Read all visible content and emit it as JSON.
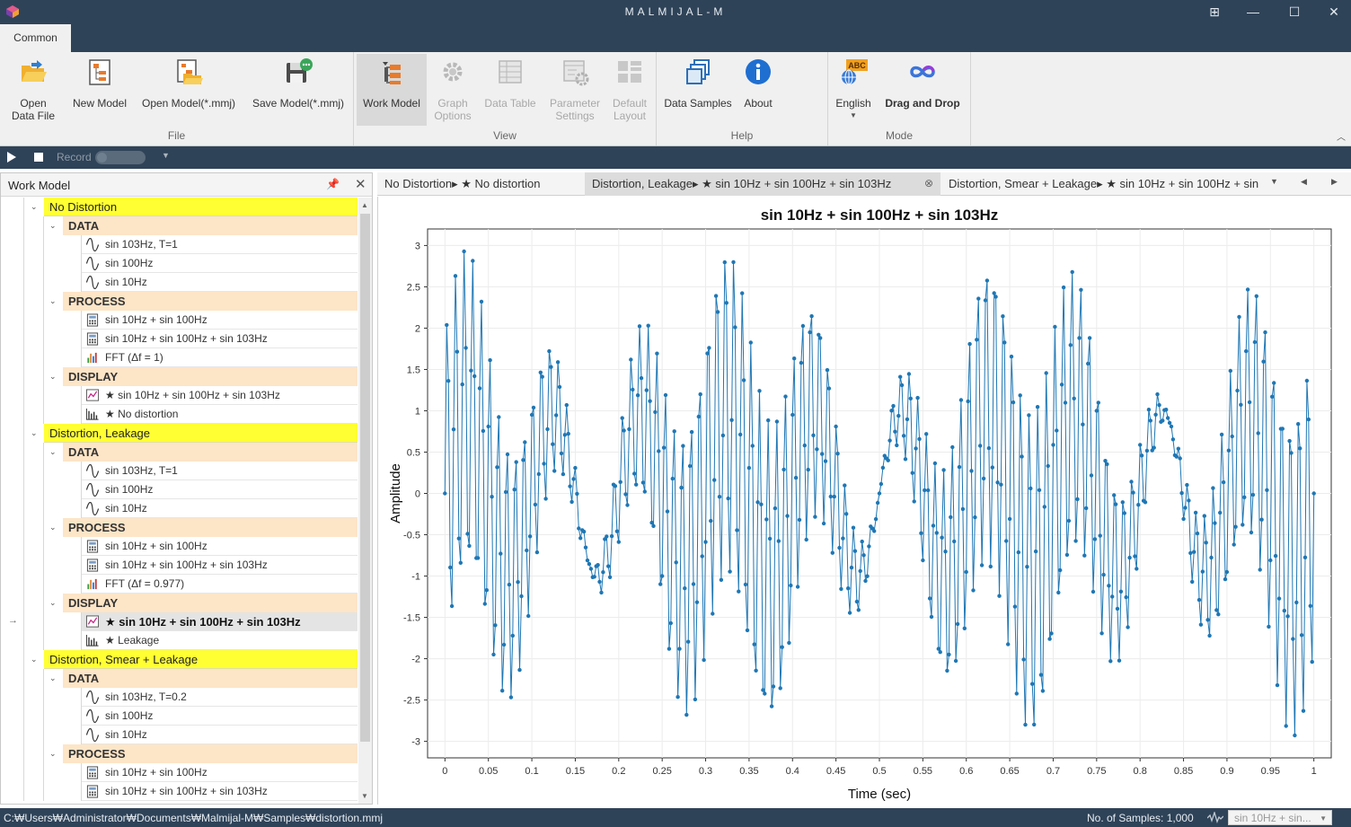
{
  "window": {
    "title": "MALMIJAL-M",
    "controls": [
      "restore-icon",
      "minimize-icon",
      "maximize-icon",
      "close-icon"
    ]
  },
  "ribbon": {
    "tab": "Common",
    "groups": {
      "file": {
        "label": "File",
        "buttons": [
          {
            "label": "Open Data File",
            "icon": "open-folder-icon"
          },
          {
            "label": "New Model",
            "icon": "new-model-icon"
          },
          {
            "label": "Open Model(*.mmj)",
            "icon": "open-model-icon"
          },
          {
            "label": "Save Model(*.mmj)",
            "icon": "save-model-icon"
          }
        ]
      },
      "view": {
        "label": "View",
        "buttons": [
          {
            "label": "Work Model",
            "icon": "work-model-icon",
            "state": "active"
          },
          {
            "label": "Graph Options",
            "icon": "graph-options-icon",
            "state": "disabled"
          },
          {
            "label": "Data Table",
            "icon": "data-table-icon",
            "state": "disabled"
          },
          {
            "label": "Parameter Settings",
            "icon": "parameter-settings-icon",
            "state": "disabled"
          },
          {
            "label": "Default Layout",
            "icon": "default-layout-icon",
            "state": "disabled"
          }
        ]
      },
      "help": {
        "label": "Help",
        "buttons": [
          {
            "label": "Data Samples",
            "icon": "data-samples-icon"
          },
          {
            "label": "About",
            "icon": "info-icon"
          }
        ]
      },
      "mode": {
        "label": "Mode",
        "buttons": [
          {
            "label": "English",
            "icon": "language-abc-icon"
          },
          {
            "label": "Drag and Drop",
            "icon": "drag-drop-icon"
          }
        ]
      }
    }
  },
  "toolbar": {
    "record_label": "Record"
  },
  "panel": {
    "title": "Work Model",
    "tree": [
      {
        "level": 1,
        "label": "No Distortion"
      },
      {
        "level": 2,
        "label": "DATA"
      },
      {
        "level": 3,
        "label": "sin 103Hz, T=1",
        "icon": "sine-wave-icon"
      },
      {
        "level": 3,
        "label": "sin 100Hz",
        "icon": "sine-wave-icon"
      },
      {
        "level": 3,
        "label": "sin 10Hz",
        "icon": "sine-wave-icon"
      },
      {
        "level": 2,
        "label": "PROCESS"
      },
      {
        "level": 3,
        "label": "sin 10Hz + sin 100Hz",
        "icon": "calculator-icon"
      },
      {
        "level": 3,
        "label": "sin 10Hz + sin 100Hz + sin 103Hz",
        "icon": "calculator-icon"
      },
      {
        "level": 3,
        "label": "FFT (Δf = 1)",
        "icon": "fft-icon"
      },
      {
        "level": 2,
        "label": "DISPLAY"
      },
      {
        "level": 3,
        "label": "★ sin 10Hz + sin 100Hz + sin 103Hz",
        "icon": "line-chart-icon"
      },
      {
        "level": 3,
        "label": "★ No distortion",
        "icon": "bar-chart-icon"
      },
      {
        "level": 1,
        "label": "Distortion, Leakage"
      },
      {
        "level": 2,
        "label": "DATA"
      },
      {
        "level": 3,
        "label": "sin 103Hz, T=1",
        "icon": "sine-wave-icon"
      },
      {
        "level": 3,
        "label": "sin 100Hz",
        "icon": "sine-wave-icon"
      },
      {
        "level": 3,
        "label": "sin 10Hz",
        "icon": "sine-wave-icon"
      },
      {
        "level": 2,
        "label": "PROCESS"
      },
      {
        "level": 3,
        "label": "sin 10Hz + sin 100Hz",
        "icon": "calculator-icon"
      },
      {
        "level": 3,
        "label": "sin 10Hz + sin 100Hz + sin 103Hz",
        "icon": "calculator-icon"
      },
      {
        "level": 3,
        "label": "FFT (Δf = 0.977)",
        "icon": "fft-icon"
      },
      {
        "level": 2,
        "label": "DISPLAY"
      },
      {
        "level": 3,
        "label": "★ sin 10Hz + sin 100Hz + sin 103Hz",
        "icon": "line-chart-icon",
        "selected": true
      },
      {
        "level": 3,
        "label": "★ Leakage",
        "icon": "bar-chart-icon"
      },
      {
        "level": 1,
        "label": "Distortion, Smear + Leakage"
      },
      {
        "level": 2,
        "label": "DATA"
      },
      {
        "level": 3,
        "label": "sin 103Hz, T=0.2",
        "icon": "sine-wave-icon"
      },
      {
        "level": 3,
        "label": "sin 100Hz",
        "icon": "sine-wave-icon"
      },
      {
        "level": 3,
        "label": "sin 10Hz",
        "icon": "sine-wave-icon"
      },
      {
        "level": 2,
        "label": "PROCESS"
      },
      {
        "level": 3,
        "label": "sin 10Hz + sin 100Hz",
        "icon": "calculator-icon"
      },
      {
        "level": 3,
        "label": "sin 10Hz + sin 100Hz + sin 103Hz",
        "icon": "calculator-icon"
      }
    ]
  },
  "doc_tabs": [
    {
      "label": "No Distortion▸ ★ No distortion"
    },
    {
      "label": "Distortion, Leakage▸ ★ sin 10Hz + sin 100Hz + sin 103Hz",
      "active": true
    },
    {
      "label": "Distortion, Smear + Leakage▸ ★ sin 10Hz + sin 100Hz + sin 103Hz"
    }
  ],
  "chart_data": {
    "type": "line",
    "title": "sin 10Hz + sin 100Hz + sin 103Hz",
    "xlabel": "Time (sec)",
    "ylabel": "Amplitude",
    "xlim": [
      -0.02,
      1.02
    ],
    "ylim": [
      -3.2,
      3.2
    ],
    "xticks": [
      "0",
      "0.05",
      "0.1",
      "0.15",
      "0.2",
      "0.25",
      "0.3",
      "0.35",
      "0.4",
      "0.45",
      "0.5",
      "0.55",
      "0.6",
      "0.65",
      "0.7",
      "0.75",
      "0.8",
      "0.85",
      "0.9",
      "0.95",
      "1"
    ],
    "yticks": [
      "3",
      "2.5",
      "2",
      "1.5",
      "1",
      "0.5",
      "0",
      "-0.5",
      "-1",
      "-1.5",
      "-2",
      "-2.5",
      "-3"
    ],
    "grid": true,
    "series": [
      {
        "color": "#1f77b4",
        "markers": true,
        "formula": "sin(2π·10·t) + sin(2π·100·t) + sin(2π·103·t)",
        "x_start": 0,
        "x_step": 0.002,
        "sample_count": 501
      }
    ]
  },
  "status": {
    "path": "C:₩Users₩Administrator₩Documents₩Malmijal-M₩Samples₩distortion.mmj",
    "samples": "No. of Samples: 1,000",
    "series_combo": "sin 10Hz + sin..."
  }
}
